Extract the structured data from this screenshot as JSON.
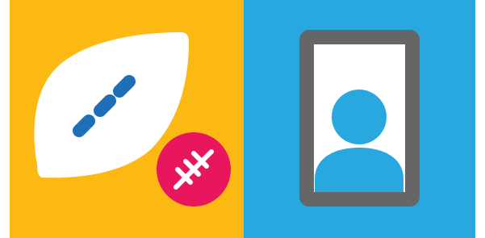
{
  "panels": [
    {
      "id": "left",
      "background": "#FDB913",
      "icons": [
        "football-icon",
        "stitch-badge-icon"
      ]
    },
    {
      "id": "right",
      "background": "#29A8E0",
      "icons": [
        "tablet-icon",
        "person-avatar-icon"
      ]
    }
  ],
  "colors": {
    "ball_body": "#ffffff",
    "ball_laces": "#1F6FB8",
    "badge": "#E8175D",
    "badge_stitches": "#ffffff",
    "tablet_frame": "#666666",
    "tablet_screen": "#ffffff",
    "avatar": "#29A8E0"
  }
}
